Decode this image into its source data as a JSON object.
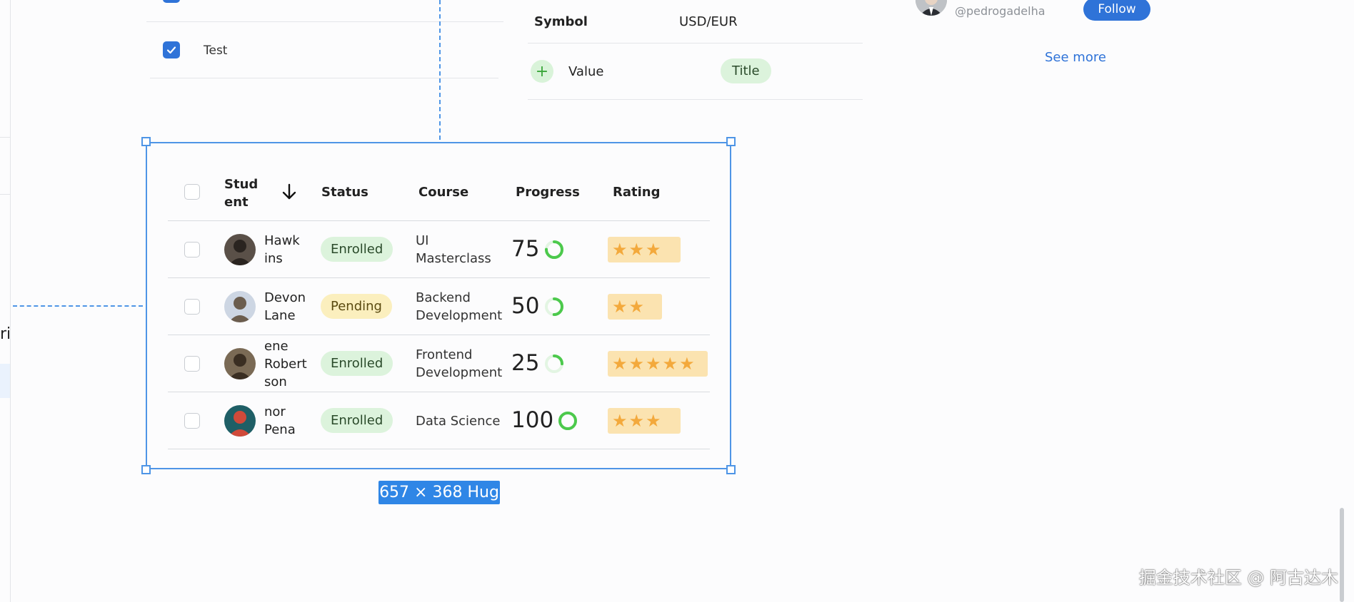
{
  "left_fragment": "ri",
  "top_list": {
    "item_label": "Test"
  },
  "info_table": {
    "symbol_label": "Symbol",
    "symbol_value": "USD/EUR",
    "value_label": "Value",
    "value_tag": "Title",
    "add_icon": "plus-icon"
  },
  "profile": {
    "handle": "@pedrogadelha",
    "follow_label": "Follow",
    "see_more_label": "See more"
  },
  "selection": {
    "size_label": "657 × 368 Hug"
  },
  "table": {
    "headers": {
      "student_line1": "Stud",
      "student_line2": "ent",
      "status": "Status",
      "course": "Course",
      "progress": "Progress",
      "rating": "Rating"
    },
    "sort_icon": "arrow-down-icon",
    "rows": [
      {
        "name_lines": [
          "Hawk",
          "ins"
        ],
        "status": "Enrolled",
        "course_lines": [
          "UI",
          "Masterclass"
        ],
        "progress": "75",
        "progress_value": 0.75,
        "rating": 3
      },
      {
        "name_lines": [
          "Devon",
          "Lane"
        ],
        "status": "Pending",
        "course_lines": [
          "Backend",
          "Development"
        ],
        "progress": "50",
        "progress_value": 0.5,
        "rating": 2
      },
      {
        "name_lines": [
          "ene",
          "Robert",
          "son"
        ],
        "status": "Enrolled",
        "course_lines": [
          "Frontend",
          "Development"
        ],
        "progress": "25",
        "progress_value": 0.25,
        "rating": 4.5
      },
      {
        "name_lines": [
          "nor",
          "Pena"
        ],
        "status": "Enrolled",
        "course_lines": [
          "Data Science"
        ],
        "progress": "100",
        "progress_value": 1.0,
        "rating": 3
      }
    ]
  },
  "watermark": "掘金技术社区 @ 阿古达木",
  "colors": {
    "accent": "#2f73d8",
    "selection": "#4e95e6",
    "enrolled_bg": "#dcf3dc",
    "pending_bg": "#fbefbe",
    "progress_ring": "#4cc94c",
    "star": "#f3a93c",
    "rating_bg": "#fbe3b0"
  }
}
